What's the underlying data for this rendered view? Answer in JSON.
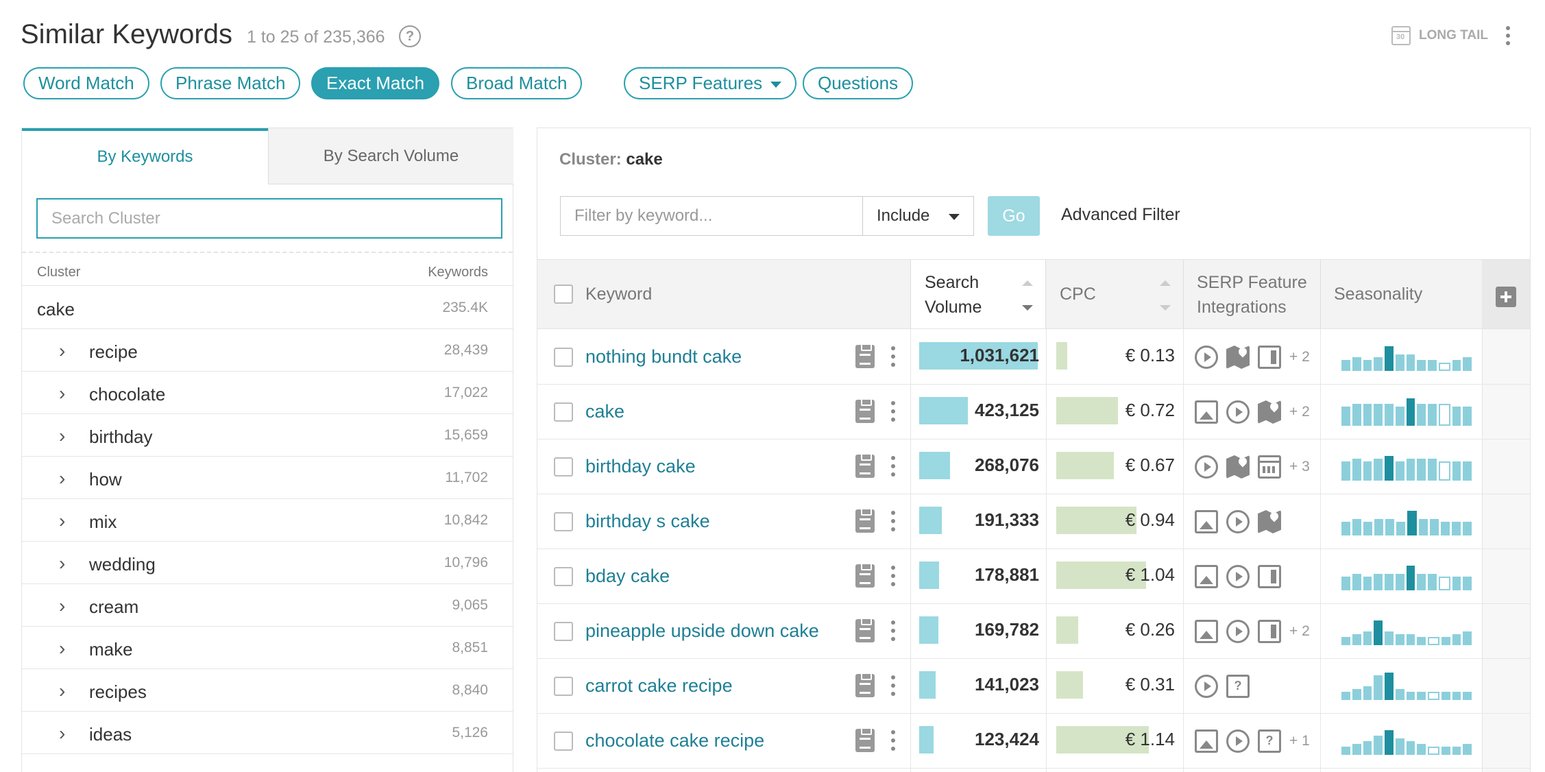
{
  "header": {
    "title": "Similar Keywords",
    "count": "1 to 25 of 235,366",
    "help": "?",
    "long_tail_label": "LONG TAIL",
    "calendar_num": "30"
  },
  "pills": [
    {
      "label": "Word Match",
      "active": false
    },
    {
      "label": "Phrase Match",
      "active": false
    },
    {
      "label": "Exact Match",
      "active": true
    },
    {
      "label": "Broad Match",
      "active": false
    },
    {
      "label": "SERP Features",
      "active": false
    },
    {
      "label": "Questions",
      "active": false
    }
  ],
  "left": {
    "tabs": [
      "By Keywords",
      "By Search Volume"
    ],
    "search_placeholder": "Search Cluster",
    "col_cluster": "Cluster",
    "col_keywords": "Keywords",
    "chevron": "›",
    "rows": [
      {
        "name": "cake",
        "count": "235.4K",
        "child": false
      },
      {
        "name": "recipe",
        "count": "28,439",
        "child": true
      },
      {
        "name": "chocolate",
        "count": "17,022",
        "child": true
      },
      {
        "name": "birthday",
        "count": "15,659",
        "child": true
      },
      {
        "name": "how",
        "count": "11,702",
        "child": true
      },
      {
        "name": "mix",
        "count": "10,842",
        "child": true
      },
      {
        "name": "wedding",
        "count": "10,796",
        "child": true
      },
      {
        "name": "cream",
        "count": "9,065",
        "child": true
      },
      {
        "name": "make",
        "count": "8,851",
        "child": true
      },
      {
        "name": "recipes",
        "count": "8,840",
        "child": true
      },
      {
        "name": "ideas",
        "count": "5,126",
        "child": true
      }
    ]
  },
  "right": {
    "cluster_prefix": "Cluster:",
    "cluster_name": "cake",
    "filter_placeholder": "Filter by keyword...",
    "include_label": "Include",
    "go_label": "Go",
    "advanced_filter": "Advanced Filter",
    "columns": {
      "keyword": "Keyword",
      "search_volume_1": "Search",
      "search_volume_2": "Volume",
      "cpc": "CPC",
      "serp_1": "SERP Feature",
      "serp_2": "Integrations",
      "seasonality": "Seasonality"
    },
    "rows": [
      {
        "keyword": "nothing bundt cake",
        "volume": "1,031,621",
        "vol_frac": 1.0,
        "cpc": "€ 0.13",
        "cpc_frac": 0.12,
        "serp": [
          "play-icon",
          "map-icon",
          "card-icon"
        ],
        "more": "+ 2",
        "season": [
          0.4,
          0.5,
          0.4,
          0.5,
          0.9,
          0.6,
          0.6,
          0.4,
          0.4,
          0.3,
          0.4,
          0.5
        ],
        "season_hi": [
          4
        ],
        "season_lo": [
          9
        ]
      },
      {
        "keyword": "cake",
        "volume": "423,125",
        "vol_frac": 0.41,
        "cpc": "€ 0.72",
        "cpc_frac": 0.67,
        "serp": [
          "image-icon",
          "play-icon",
          "map-icon"
        ],
        "more": "+ 2",
        "season": [
          0.7,
          0.8,
          0.8,
          0.8,
          0.8,
          0.7,
          1.0,
          0.8,
          0.8,
          0.8,
          0.7,
          0.7
        ],
        "season_hi": [
          6
        ],
        "season_lo": [
          9
        ]
      },
      {
        "keyword": "birthday cake",
        "volume": "268,076",
        "vol_frac": 0.26,
        "cpc": "€ 0.67",
        "cpc_frac": 0.62,
        "serp": [
          "play-icon",
          "map-icon",
          "calendar-icon"
        ],
        "more": "+ 3",
        "season": [
          0.7,
          0.8,
          0.7,
          0.8,
          0.9,
          0.7,
          0.8,
          0.8,
          0.8,
          0.7,
          0.7,
          0.7
        ],
        "season_hi": [
          4
        ],
        "season_lo": [
          9
        ]
      },
      {
        "keyword": "birthday s cake",
        "volume": "191,333",
        "vol_frac": 0.19,
        "cpc": "€ 0.94",
        "cpc_frac": 0.87,
        "serp": [
          "image-icon",
          "play-icon",
          "map-icon"
        ],
        "more": "",
        "season": [
          0.5,
          0.6,
          0.5,
          0.6,
          0.6,
          0.5,
          0.9,
          0.6,
          0.6,
          0.5,
          0.5,
          0.5
        ],
        "season_hi": [
          6
        ],
        "season_lo": []
      },
      {
        "keyword": "bday cake",
        "volume": "178,881",
        "vol_frac": 0.17,
        "cpc": "€ 1.04",
        "cpc_frac": 0.97,
        "serp": [
          "image-icon",
          "play-icon",
          "card-icon"
        ],
        "more": "",
        "season": [
          0.5,
          0.6,
          0.5,
          0.6,
          0.6,
          0.6,
          0.9,
          0.6,
          0.6,
          0.5,
          0.5,
          0.5
        ],
        "season_hi": [
          6
        ],
        "season_lo": [
          9
        ]
      },
      {
        "keyword": "pineapple upside down cake",
        "volume": "169,782",
        "vol_frac": 0.16,
        "cpc": "€ 0.26",
        "cpc_frac": 0.24,
        "serp": [
          "image-icon",
          "play-icon",
          "card-icon"
        ],
        "more": "+ 2",
        "season": [
          0.3,
          0.4,
          0.5,
          0.9,
          0.5,
          0.4,
          0.4,
          0.3,
          0.3,
          0.3,
          0.4,
          0.5
        ],
        "season_hi": [
          3
        ],
        "season_lo": [
          8
        ]
      },
      {
        "keyword": "carrot cake recipe",
        "volume": "141,023",
        "vol_frac": 0.14,
        "cpc": "€ 0.31",
        "cpc_frac": 0.29,
        "serp": [
          "play-icon",
          "qa-icon"
        ],
        "more": "",
        "season": [
          0.3,
          0.4,
          0.5,
          0.9,
          1.0,
          0.4,
          0.3,
          0.3,
          0.3,
          0.3,
          0.3,
          0.3
        ],
        "season_hi": [
          4
        ],
        "season_lo": [
          8
        ]
      },
      {
        "keyword": "chocolate cake recipe",
        "volume": "123,424",
        "vol_frac": 0.12,
        "cpc": "€ 1.14",
        "cpc_frac": 1.0,
        "serp": [
          "image-icon",
          "play-icon",
          "qa-icon"
        ],
        "more": "+ 1",
        "season": [
          0.3,
          0.4,
          0.5,
          0.7,
          0.9,
          0.6,
          0.5,
          0.4,
          0.3,
          0.3,
          0.3,
          0.4
        ],
        "season_hi": [
          4
        ],
        "season_lo": [
          8
        ]
      }
    ]
  },
  "colors": {
    "accent": "#2aa0b0",
    "link": "#1e7f95",
    "volume_bar": "#9ad8e2",
    "cpc_bar": "#d5e4c6"
  }
}
